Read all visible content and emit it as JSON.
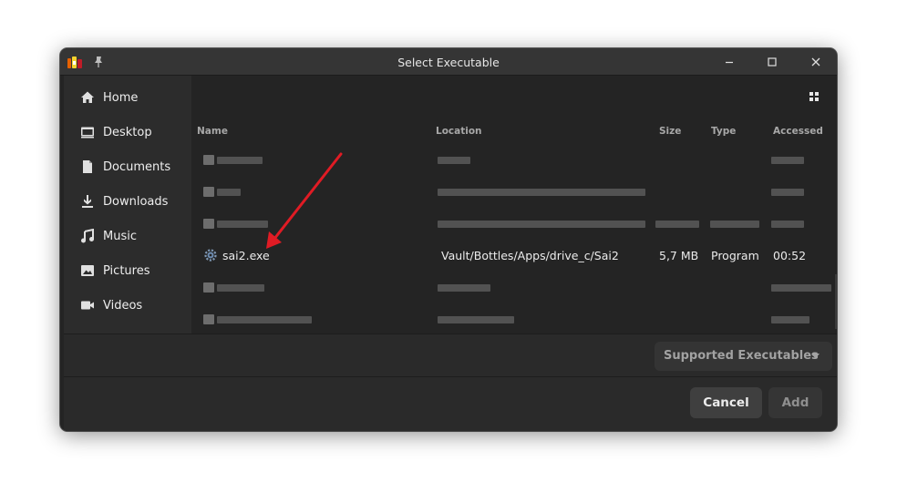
{
  "window": {
    "title": "Select Executable"
  },
  "sidebar": {
    "items": [
      {
        "label": "Home",
        "icon": "home-icon"
      },
      {
        "label": "Desktop",
        "icon": "desktop-icon"
      },
      {
        "label": "Documents",
        "icon": "document-icon"
      },
      {
        "label": "Downloads",
        "icon": "download-icon"
      },
      {
        "label": "Music",
        "icon": "music-icon"
      },
      {
        "label": "Pictures",
        "icon": "pictures-icon"
      },
      {
        "label": "Videos",
        "icon": "video-icon"
      }
    ]
  },
  "columns": {
    "name": "Name",
    "location": "Location",
    "size": "Size",
    "type": "Type",
    "accessed": "Accessed"
  },
  "files": {
    "visible_row": {
      "name": "sai2.exe",
      "location": "Vault/Bottles/Apps/drive_c/Sai2",
      "size": "5,7 MB",
      "type": "Program",
      "accessed": "00:52"
    }
  },
  "filter": {
    "label": "Supported Executables"
  },
  "buttons": {
    "cancel": "Cancel",
    "add": "Add"
  },
  "colors": {
    "background": "#242424",
    "sidebar": "#2c2c2c",
    "titlebar": "#353535",
    "annotation_arrow": "#e01b24"
  }
}
